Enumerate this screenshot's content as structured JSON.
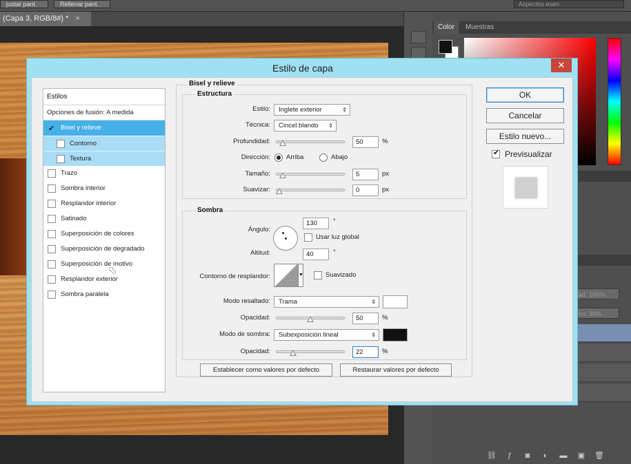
{
  "ps": {
    "top_buttons": [
      "justar pant.",
      "Rellenar pant."
    ],
    "workspace": "Aspectos esen.",
    "document_tab": "(Capa 3, RGB/8#) *",
    "document_tab_close": "×",
    "panel_tabs": [
      "Color",
      "Muestras"
    ],
    "layers_fields": [
      {
        "label": "dad:",
        "value": "100%"
      },
      {
        "label": "eno:",
        "value": "90%"
      }
    ],
    "bottom_icons": [
      "link-icon",
      "fx-icon",
      "mask-icon",
      "adjustment-icon",
      "folder-icon",
      "new-layer-icon",
      "trash-icon"
    ],
    "colors": {
      "foreground": "#111111",
      "background": "#ffffff",
      "selected_layer": "#7790b2"
    }
  },
  "dialog": {
    "title": "Estilo de capa",
    "close_label": "✕",
    "styles_header": "Estilos",
    "blending_options": "Opciones de fusión: A medida",
    "style_items": [
      {
        "label": "Bisel y relieve",
        "checked": true,
        "state": "selected"
      },
      {
        "label": "Contorno",
        "checked": false,
        "state": "sub"
      },
      {
        "label": "Textura",
        "checked": false,
        "state": "sub"
      },
      {
        "label": "Trazo",
        "checked": false
      },
      {
        "label": "Sombra interior",
        "checked": false
      },
      {
        "label": "Resplandor interior",
        "checked": false
      },
      {
        "label": "Satinado",
        "checked": false
      },
      {
        "label": "Superposición de colores",
        "checked": false
      },
      {
        "label": "Superposición de degradado",
        "checked": false
      },
      {
        "label": "Superposición de motivo",
        "checked": false
      },
      {
        "label": "Resplandor exterior",
        "checked": false
      },
      {
        "label": "Sombra paralela",
        "checked": false
      }
    ],
    "bevel": {
      "section_title": "Bisel y relieve",
      "structure_title": "Estructura",
      "style_label": "Estilo:",
      "style_value": "Inglete exterior",
      "technique_label": "Técnica:",
      "technique_value": "Cincel blando",
      "depth_label": "Profundidad:",
      "depth_value": "50",
      "depth_unit": "%",
      "depth_fraction": 0.05,
      "direction_label": "Dirección:",
      "direction_up": "Arriba",
      "direction_down": "Abajo",
      "size_label": "Tamaño:",
      "size_value": "5",
      "size_unit": "px",
      "size_fraction": 0.05,
      "soften_label": "Suavizar:",
      "soften_value": "0",
      "soften_unit": "px",
      "soften_fraction": 0.0
    },
    "shading": {
      "title": "Sombra",
      "angle_label": "Ángulo:",
      "angle_value": "130",
      "angle_unit": "°",
      "global_light_label": "Usar luz global",
      "altitude_label": "Altitud:",
      "altitude_value": "40",
      "altitude_unit": "°",
      "gloss_contour_label": "Contorno de resplandor:",
      "antialiased_label": "Suavizado",
      "highlight_mode_label": "Modo resaltado:",
      "highlight_mode_value": "Trama",
      "highlight_color": "#ffffff",
      "highlight_opacity_label": "Opacidad:",
      "highlight_opacity_value": "50",
      "highlight_opacity_unit": "%",
      "highlight_opacity_fraction": 0.5,
      "shadow_mode_label": "Modo de sombra:",
      "shadow_mode_value": "Subexposición lineal",
      "shadow_color": "#111111",
      "shadow_opacity_label": "Opacidad:",
      "shadow_opacity_value": "22",
      "shadow_opacity_unit": "%",
      "shadow_opacity_fraction": 0.22
    },
    "make_default": "Establecer como valores por defecto",
    "reset_default": "Restaurar valores por defecto",
    "ok": "OK",
    "cancel": "Cancelar",
    "new_style": "Estilo nuevo...",
    "preview_label": "Previsualizar",
    "preview_checked": true
  }
}
